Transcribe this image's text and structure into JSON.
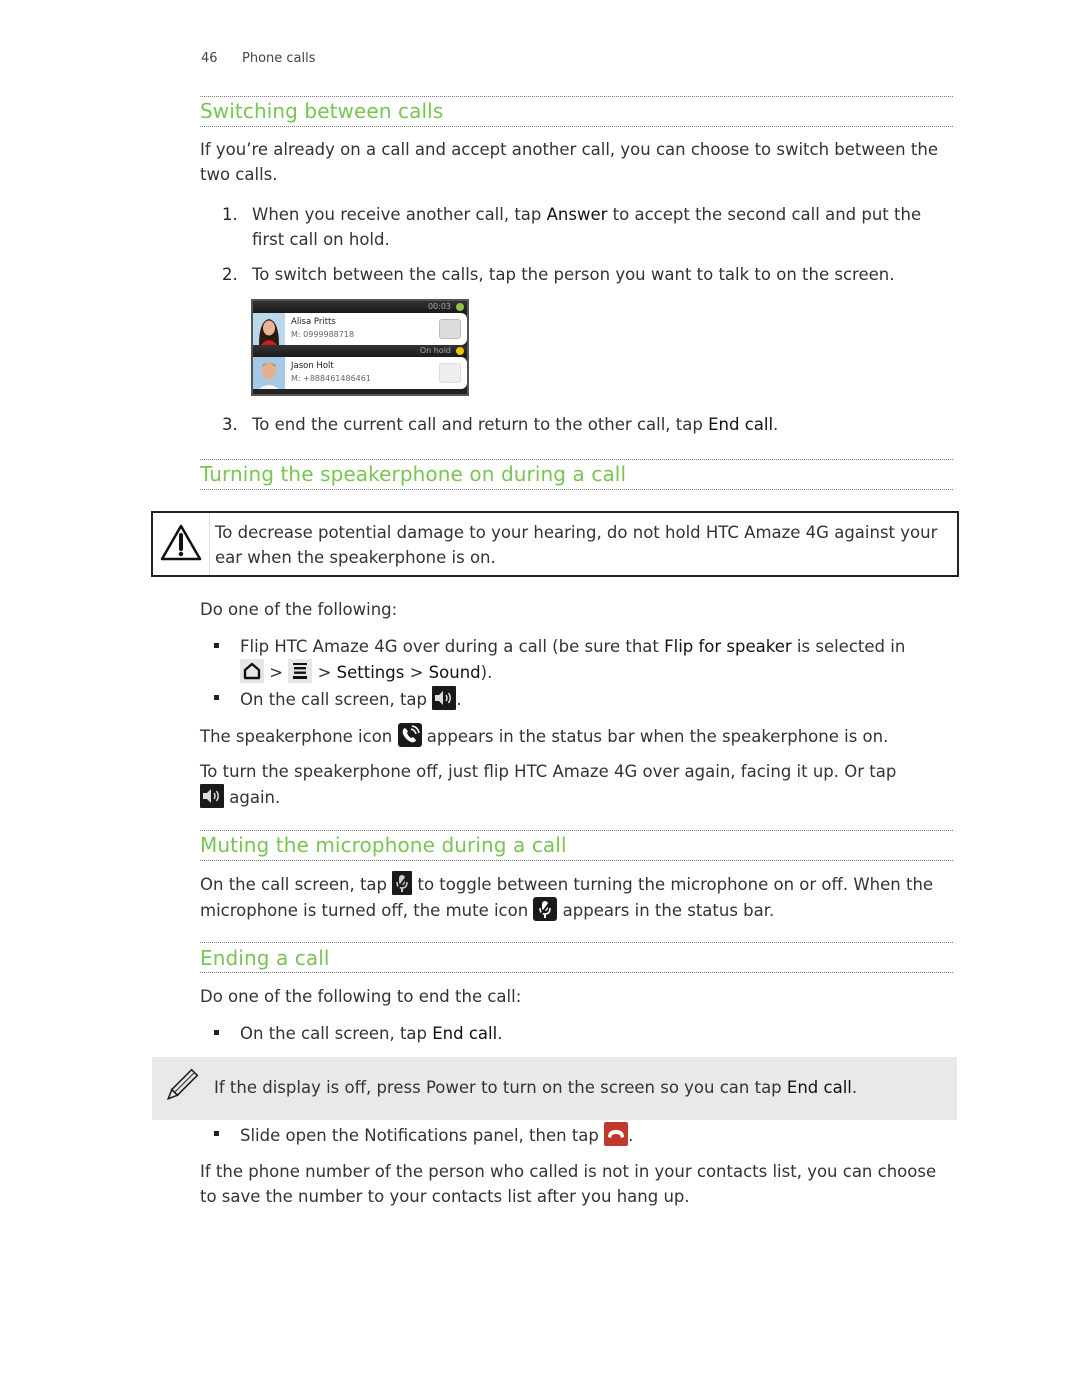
{
  "header": {
    "page_number": "46",
    "chapter": "Phone calls"
  },
  "sections": {
    "switching": {
      "title": "Switching between calls",
      "intro": "If you’re already on a call and accept another call, you can choose to switch between the two calls.",
      "steps": [
        {
          "num": "1.",
          "pre": "When you receive another call, tap ",
          "bold": "Answer",
          "post": " to accept the second call and put the first call on hold."
        },
        {
          "num": "2.",
          "text": "To switch between the calls, tap the person you want to talk to on the screen."
        },
        {
          "num": "3.",
          "pre": "To end the current call and return to the other call, tap ",
          "bold": "End call",
          "post": "."
        }
      ],
      "screenshot": {
        "calls": [
          {
            "status": "00:03",
            "status_color": "#8bc53f",
            "name": "Alisa Pritts",
            "number": "M: 0999988718"
          },
          {
            "status": "On hold",
            "status_color": "#f2c200",
            "name": "Jason Holt",
            "number": "M: +888461486461"
          }
        ]
      }
    },
    "speakerphone": {
      "title": "Turning the speakerphone on during a call",
      "warning": "To decrease potential damage to your hearing, do not hold HTC Amaze 4G against your ear when the speakerphone is on.",
      "intro": "Do one of the following:",
      "bullet1": {
        "pre": "Flip HTC Amaze 4G over during a call (be sure that ",
        "bold": "Flip for speaker",
        "mid": " is selected in",
        "sep1": " > ",
        "sep2": " > ",
        "settings": "Settings",
        "sep3": " > ",
        "sound": "Sound",
        "end": ")."
      },
      "bullet2": {
        "pre": "On the call screen, tap ",
        "post": "."
      },
      "para1": {
        "pre": "The speakerphone icon ",
        "post": " appears in the status bar when the speakerphone is on."
      },
      "para2": {
        "pre": "To turn the speakerphone off, just flip HTC Amaze 4G over again, facing it up. Or tap",
        "post": " again."
      }
    },
    "muting": {
      "title": "Muting the microphone during a call",
      "para": {
        "pre": "On the call screen, tap ",
        "mid": " to toggle between turning the microphone on or off. When the microphone is turned off, the mute icon ",
        "post": " appears in the status bar."
      }
    },
    "ending": {
      "title": "Ending a call",
      "intro": "Do one of the following to end the call:",
      "bullet1": {
        "pre": "On the call screen, tap ",
        "bold": "End call",
        "post": "."
      },
      "note": {
        "pre": "If the display is off, press Power to turn on the screen so you can tap ",
        "bold": "End call",
        "post": "."
      },
      "bullet2": {
        "pre": "Slide open the Notifications panel, then tap ",
        "post": "."
      },
      "outro": "If the phone number of the person who called is not in your contacts list, you can choose to save the number to your contacts list after you hang up."
    }
  },
  "icons": {
    "warning": "warning-triangle-icon",
    "note": "pencil-icon",
    "home": "home-icon",
    "menu": "menu-icon",
    "speaker": "speaker-icon",
    "speakerphone_status": "speakerphone-status-icon",
    "mic": "microphone-icon",
    "mute_status": "mute-status-icon",
    "end_call": "end-call-icon"
  },
  "colors": {
    "heading": "#79c454",
    "note_bg": "#e9e9e9",
    "end_call_red": "#c0392b"
  }
}
